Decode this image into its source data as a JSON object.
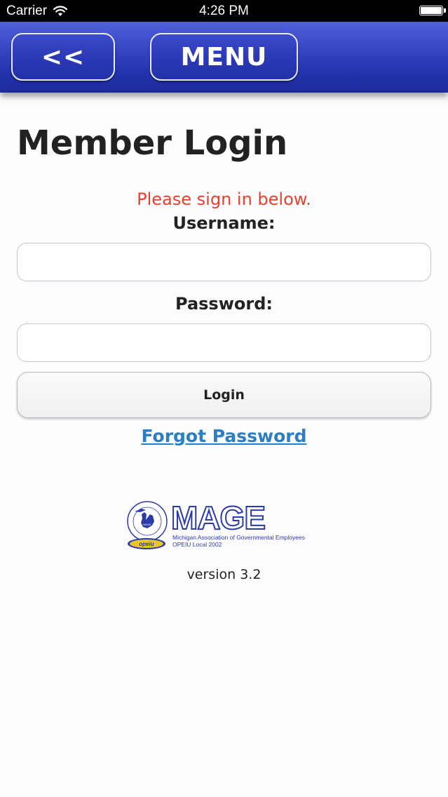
{
  "status_bar": {
    "carrier": "Carrier",
    "time": "4:26 PM",
    "wifi_icon": "wifi-icon",
    "battery_icon": "battery-icon",
    "battery_level": 1.0
  },
  "header": {
    "back_label": "<<",
    "menu_label": "MENU"
  },
  "page": {
    "title": "Member Login",
    "prompt": "Please sign in below.",
    "username_label": "Username:",
    "username_value": "",
    "password_label": "Password:",
    "password_value": "",
    "login_label": "Login",
    "forgot_label": "Forgot Password"
  },
  "logo": {
    "brand": "MAGE",
    "line1": "Michigan Association of Governmental Employees",
    "line2": "OPEIU Local 2002",
    "seal_text": "WHERE THE EXCLUDED ARE INCLUDED",
    "seal_badge": "opeiu"
  },
  "footer": {
    "version": "version 3.2"
  },
  "colors": {
    "header_blue": "#2a38b8",
    "prompt_red": "#e8402a",
    "link_blue": "#2a7ec4",
    "logo_blue": "#2a3aa8"
  }
}
